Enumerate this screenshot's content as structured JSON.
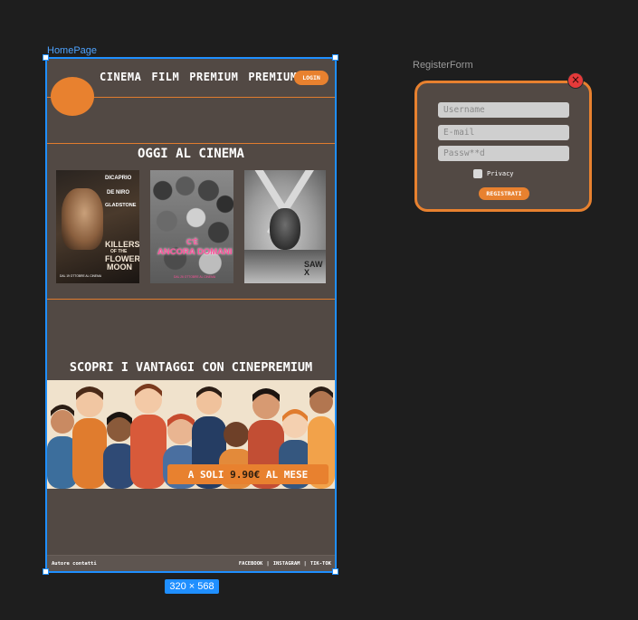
{
  "homepage": {
    "frame_label": "HomePage",
    "nav": {
      "links": [
        "CINEMA",
        "FILM",
        "PREMIUM",
        "PREMIUM"
      ],
      "login_label": "LOGIN"
    },
    "today_title": "OGGI AL CINEMA",
    "posters": [
      {
        "top_line_1": "DICAPRIO",
        "top_line_2": "DE NIRO",
        "top_line_3": "GLADSTONE",
        "title_1": "KILLERS",
        "title_2": "OF THE",
        "title_3": "FLOWER",
        "title_4": "MOON",
        "bottom": "DAL 19 OTTOBRE AL CINEMA"
      },
      {
        "title_1": "C'È",
        "title_2": "ANCORA DOMANI",
        "bottom": "DAL 26 OTTOBRE AL CINEMA"
      },
      {
        "title_1": "SAW X"
      }
    ],
    "promo_title": "SCOPRI I VANTAGGI CON CINEPREMIUM",
    "price_badge": {
      "prefix": "A SOLI ",
      "price": "9.90€",
      "suffix": " AL MESE"
    },
    "footer": {
      "left": "Autore contatti",
      "right_links": [
        "FACEBOOK",
        "|",
        "INSTAGRAM",
        "|",
        "TIK-TOK"
      ]
    },
    "size_badge": "320 × 568"
  },
  "register_form": {
    "frame_label": "RegisterForm",
    "username_placeholder": "Username",
    "email_placeholder": "E-mail",
    "password_placeholder": "Passw**d",
    "privacy_label": "Privacy",
    "submit_label": "REGISTRATI",
    "close_icon": "close-icon"
  },
  "colors": {
    "accent": "#e8812f",
    "frame_bg": "#524944",
    "canvas_bg": "#1e1e1e",
    "selection": "#1f8fff",
    "close": "#e53a3a"
  }
}
